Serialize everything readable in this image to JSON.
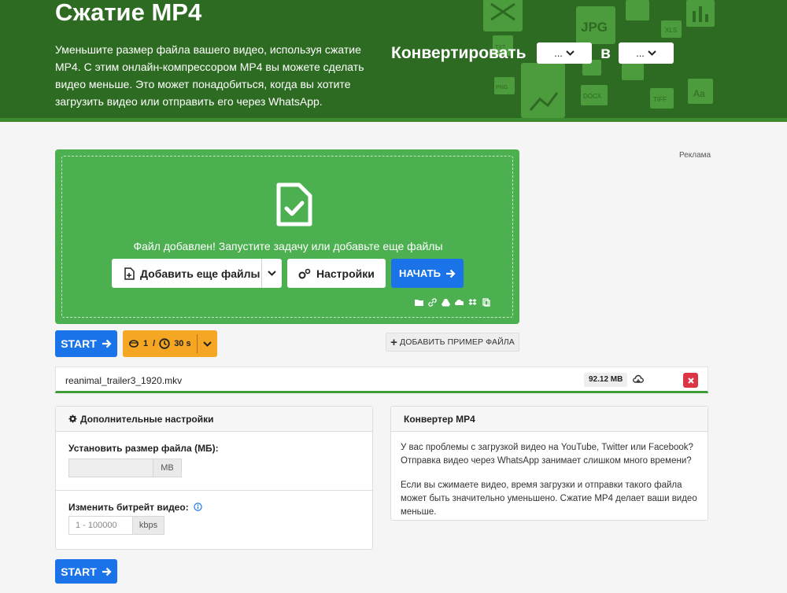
{
  "hero": {
    "title": "Сжатие MP4",
    "description": "Уменьшите размер файла вашего видео, используя сжатие MP4. С этим онлайн-компрессором MP4 вы можете сделать видео меньше. Это может понадобиться, когда вы хотите загрузить видео или отправить его через WhatsApp.",
    "convert_label": "Конвертировать",
    "to_label": "в",
    "from_select": "...",
    "to_select": "...",
    "deco_labels": {
      "jpg": "JPG",
      "png": "PNG",
      "docx": "DOCX",
      "tiff": "TIFF",
      "aa": "Aa",
      "xls": "XLS",
      "txt": "TXT"
    }
  },
  "ad_label": "Реклама",
  "upload": {
    "message": "Файл добавлен! Запустите задачу или добавьте еще файлы",
    "add_files_label": "Добавить еще файлы",
    "settings_label": "Настройки",
    "start_label": "НАЧАТЬ",
    "sources": [
      "folder-icon",
      "link-icon",
      "google-drive-icon",
      "onedrive-icon",
      "dropbox-icon",
      "clipboard-icon"
    ]
  },
  "actions": {
    "start_label": "START",
    "limit_count": "1",
    "limit_sep": "/",
    "limit_time": "30 s",
    "sample_label": "ДОБАВИТЬ ПРИМЕР ФАЙЛА"
  },
  "file": {
    "name": "reanimal_trailer3_1920.mkv",
    "size": "92.12 MB"
  },
  "advanced": {
    "title": "Дополнительные настройки",
    "size_label": "Установить размер файла (МБ):",
    "size_unit": "MB",
    "size_value": "",
    "bitrate_label": "Изменить битрейт видео:",
    "bitrate_placeholder": "1 - 100000",
    "bitrate_unit": "kbps"
  },
  "info": {
    "title": "Конвертер MP4",
    "paragraph1": "У вас проблемы с загрузкой видео на YouTube, Twitter или Facebook? Отправка видео через WhatsApp занимает слишком много времени?",
    "paragraph2": "Если вы сжимаете видео, время загрузки и отправки такого файла может быть значительно уменьшено. Сжатие MP4 делает ваши видео меньше."
  },
  "bottom_start_label": "START",
  "colors": {
    "hero": "#2e6b22",
    "upload": "#4caf50",
    "primary": "#1a73e8",
    "warning": "#f5a623",
    "danger": "#dc3545"
  }
}
